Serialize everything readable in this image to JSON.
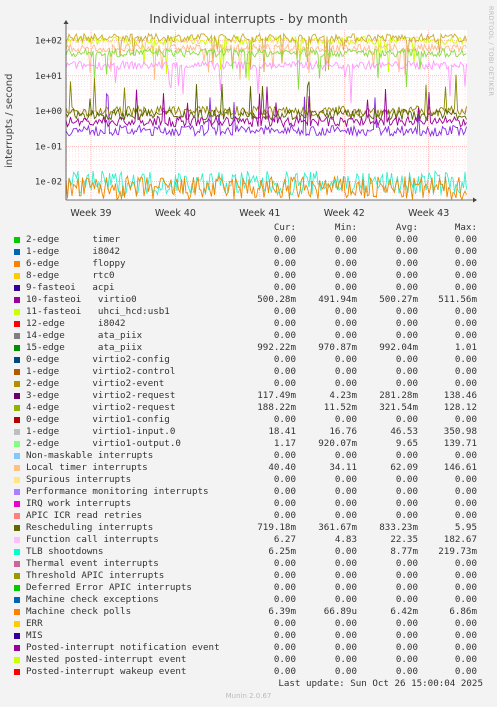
{
  "chart_data": {
    "type": "line",
    "title": "Individual interrupts - by month",
    "ylabel": "interrupts / second",
    "yscale": "log",
    "ylim": [
      0.003,
      200
    ],
    "yticks": [
      {
        "value": 100,
        "label": "1e+02"
      },
      {
        "value": 10,
        "label": "1e+01"
      },
      {
        "value": 1,
        "label": "1e+00"
      },
      {
        "value": 0.1,
        "label": "1e-01"
      },
      {
        "value": 0.01,
        "label": "1e-02"
      }
    ],
    "xticks": [
      "Week 39",
      "Week 40",
      "Week 41",
      "Week 42",
      "Week 43"
    ],
    "grid": true,
    "series": [
      {
        "name": "11-fasteoi uhci_hcd:usb1",
        "color": "#ccff00",
        "level": 100
      },
      {
        "name": "4-edge virtio2-request",
        "color": "#ccaa33",
        "level": 120
      },
      {
        "name": "Local timer interrupts",
        "color": "#ffbb88",
        "level": 60
      },
      {
        "name": "Function call interrupts",
        "color": "#ff99ff",
        "level": 20
      },
      {
        "name": "1-edge virtio1-input.0",
        "color": "#88dd44",
        "level": 45
      },
      {
        "name": "3-edge virtio2-request",
        "color": "#8a2be2",
        "level": 0.28
      },
      {
        "name": "15-edge ata_piix",
        "color": "#888800",
        "level": 0.99
      },
      {
        "name": "Rescheduling interrupts",
        "color": "#556600",
        "level": 0.8
      },
      {
        "name": "10-fasteoi virtio0",
        "color": "#990099",
        "level": 0.5
      },
      {
        "name": "TLB shootdowns",
        "color": "#33eecc",
        "level": 0.009
      },
      {
        "name": "Machine check polls",
        "color": "#ee8800",
        "level": 0.0064
      }
    ]
  },
  "legend": {
    "headers": {
      "cur": "Cur:",
      "min": "Min:",
      "avg": "Avg:",
      "max": "Max:"
    },
    "rows": [
      {
        "name": "2-edge      timer",
        "color": "#00cc00",
        "cur": "0.00",
        "min": "0.00",
        "avg": "0.00",
        "max": "0.00"
      },
      {
        "name": "1-edge      i8042",
        "color": "#0066b3",
        "cur": "0.00",
        "min": "0.00",
        "avg": "0.00",
        "max": "0.00"
      },
      {
        "name": "6-edge      floppy",
        "color": "#ff8000",
        "cur": "0.00",
        "min": "0.00",
        "avg": "0.00",
        "max": "0.00"
      },
      {
        "name": "8-edge      rtc0",
        "color": "#ffcc00",
        "cur": "0.00",
        "min": "0.00",
        "avg": "0.00",
        "max": "0.00"
      },
      {
        "name": "9-fasteoi   acpi",
        "color": "#330099",
        "cur": "0.00",
        "min": "0.00",
        "avg": "0.00",
        "max": "0.00"
      },
      {
        "name": "10-fasteoi   virtio0",
        "color": "#990099",
        "cur": "500.28m",
        "min": "491.94m",
        "avg": "500.27m",
        "max": "511.56m"
      },
      {
        "name": "11-fasteoi   uhci_hcd:usb1",
        "color": "#ccff00",
        "cur": "0.00",
        "min": "0.00",
        "avg": "0.00",
        "max": "0.00"
      },
      {
        "name": "12-edge      i8042",
        "color": "#ff0000",
        "cur": "0.00",
        "min": "0.00",
        "avg": "0.00",
        "max": "0.00"
      },
      {
        "name": "14-edge      ata_piix",
        "color": "#808080",
        "cur": "0.00",
        "min": "0.00",
        "avg": "0.00",
        "max": "0.00"
      },
      {
        "name": "15-edge      ata_piix",
        "color": "#008f00",
        "cur": "992.22m",
        "min": "970.87m",
        "avg": "992.04m",
        "max": "1.01"
      },
      {
        "name": "0-edge      virtio2-config",
        "color": "#00487d",
        "cur": "0.00",
        "min": "0.00",
        "avg": "0.00",
        "max": "0.00"
      },
      {
        "name": "1-edge      virtio2-control",
        "color": "#b35a00",
        "cur": "0.00",
        "min": "0.00",
        "avg": "0.00",
        "max": "0.00"
      },
      {
        "name": "2-edge      virtio2-event",
        "color": "#b38f00",
        "cur": "0.00",
        "min": "0.00",
        "avg": "0.00",
        "max": "0.00"
      },
      {
        "name": "3-edge      virtio2-request",
        "color": "#6b006b",
        "cur": "117.49m",
        "min": "4.23m",
        "avg": "281.28m",
        "max": "138.46"
      },
      {
        "name": "4-edge      virtio2-request",
        "color": "#8fb300",
        "cur": "188.22m",
        "min": "11.52m",
        "avg": "321.54m",
        "max": "128.12"
      },
      {
        "name": "0-edge      virtio1-config",
        "color": "#b30000",
        "cur": "0.00",
        "min": "0.00",
        "avg": "0.00",
        "max": "0.00"
      },
      {
        "name": "1-edge      virtio1-input.0",
        "color": "#bebebe",
        "cur": "18.41",
        "min": "16.76",
        "avg": "46.53",
        "max": "350.98"
      },
      {
        "name": "2-edge      virtio1-output.0",
        "color": "#80ff80",
        "cur": "1.17",
        "min": "920.07m",
        "avg": "9.65",
        "max": "139.71"
      },
      {
        "name": "Non-maskable interrupts",
        "color": "#80c9ff",
        "cur": "0.00",
        "min": "0.00",
        "avg": "0.00",
        "max": "0.00"
      },
      {
        "name": "Local timer interrupts",
        "color": "#ffc080",
        "cur": "40.40",
        "min": "34.11",
        "avg": "62.09",
        "max": "146.61"
      },
      {
        "name": "Spurious interrupts",
        "color": "#ffe680",
        "cur": "0.00",
        "min": "0.00",
        "avg": "0.00",
        "max": "0.00"
      },
      {
        "name": "Performance monitoring interrupts",
        "color": "#aa80ff",
        "cur": "0.00",
        "min": "0.00",
        "avg": "0.00",
        "max": "0.00"
      },
      {
        "name": "IRQ work interrupts",
        "color": "#ee00cc",
        "cur": "0.00",
        "min": "0.00",
        "avg": "0.00",
        "max": "0.00"
      },
      {
        "name": "APIC ICR read retries",
        "color": "#ff8080",
        "cur": "0.00",
        "min": "0.00",
        "avg": "0.00",
        "max": "0.00"
      },
      {
        "name": "Rescheduling interrupts",
        "color": "#666600",
        "cur": "719.18m",
        "min": "361.67m",
        "avg": "833.23m",
        "max": "5.95"
      },
      {
        "name": "Function call interrupts",
        "color": "#ffbfff",
        "cur": "6.27",
        "min": "4.83",
        "avg": "22.35",
        "max": "182.67"
      },
      {
        "name": "TLB shootdowns",
        "color": "#00ffcc",
        "cur": "6.25m",
        "min": "0.00",
        "avg": "8.77m",
        "max": "219.73m"
      },
      {
        "name": "Thermal event interrupts",
        "color": "#cc6699",
        "cur": "0.00",
        "min": "0.00",
        "avg": "0.00",
        "max": "0.00"
      },
      {
        "name": "Threshold APIC interrupts",
        "color": "#999900",
        "cur": "0.00",
        "min": "0.00",
        "avg": "0.00",
        "max": "0.00"
      },
      {
        "name": "Deferred Error APIC interrupts",
        "color": "#00cc00",
        "cur": "0.00",
        "min": "0.00",
        "avg": "0.00",
        "max": "0.00"
      },
      {
        "name": "Machine check exceptions",
        "color": "#0066b3",
        "cur": "0.00",
        "min": "0.00",
        "avg": "0.00",
        "max": "0.00"
      },
      {
        "name": "Machine check polls",
        "color": "#ff8000",
        "cur": "6.39m",
        "min": "66.89u",
        "avg": "6.42m",
        "max": "6.86m"
      },
      {
        "name": "ERR",
        "color": "#ffcc00",
        "cur": "0.00",
        "min": "0.00",
        "avg": "0.00",
        "max": "0.00"
      },
      {
        "name": "MIS",
        "color": "#330099",
        "cur": "0.00",
        "min": "0.00",
        "avg": "0.00",
        "max": "0.00"
      },
      {
        "name": "Posted-interrupt notification event",
        "color": "#990099",
        "cur": "0.00",
        "min": "0.00",
        "avg": "0.00",
        "max": "0.00"
      },
      {
        "name": "Nested posted-interrupt event",
        "color": "#ccff00",
        "cur": "0.00",
        "min": "0.00",
        "avg": "0.00",
        "max": "0.00"
      },
      {
        "name": "Posted-interrupt wakeup event",
        "color": "#ff0000",
        "cur": "0.00",
        "min": "0.00",
        "avg": "0.00",
        "max": "0.00"
      }
    ]
  },
  "footer": {
    "last_update": "Last update: Sun Oct 26 15:00:04 2025",
    "version": "Munin 2.0.67",
    "side_credit": "RRDTOOL / TOBI OETIKER"
  }
}
